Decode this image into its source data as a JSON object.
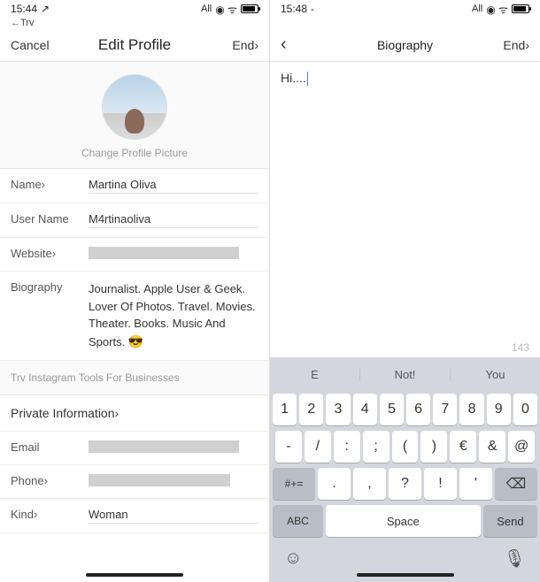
{
  "left": {
    "status": {
      "time": "15:44",
      "carrier": "All"
    },
    "try": "←Trv",
    "nav": {
      "cancel": "Cancel",
      "title": "Edit Profile",
      "done": "End›"
    },
    "changePic": "Change Profile Picture",
    "fields": {
      "name": {
        "label": "Name›",
        "value": "Martina Oliva"
      },
      "username": {
        "label": "User Name",
        "value": "M4rtinaoliva"
      },
      "website": {
        "label": "Website›",
        "value": ""
      },
      "bio": {
        "label": "Biography",
        "value": "Journalist. Apple User & Geek. Lover Of Photos. Travel. Movies. Theater. Books. Music And Sports."
      }
    },
    "tools": "Trv Instagram Tools For Businesses",
    "privateHeader": "Private Information›",
    "private": {
      "email": {
        "label": "Email",
        "value": ""
      },
      "phone": {
        "label": "Phone›",
        "value": ""
      },
      "kind": {
        "label": "Kind›",
        "value": "Woman"
      }
    }
  },
  "right": {
    "status": {
      "time": "15:48",
      "carrier": "All"
    },
    "nav": {
      "title": "Biography",
      "done": "End›"
    },
    "editorText": "Hi....",
    "charCount": "143",
    "suggestions": [
      "E",
      "Not!",
      "You"
    ],
    "keyboard": {
      "row1": [
        "1",
        "2",
        "3",
        "4",
        "5",
        "6",
        "7",
        "8",
        "9",
        "0"
      ],
      "row2": [
        "-",
        "/",
        ":",
        ";",
        "(",
        ")",
        "€",
        "&",
        "@"
      ],
      "row3_shift": "#+=",
      "row3": [
        ".",
        ",",
        "?",
        "!",
        "'"
      ],
      "abc": "ABC",
      "space": "Space",
      "send": "Send"
    }
  }
}
